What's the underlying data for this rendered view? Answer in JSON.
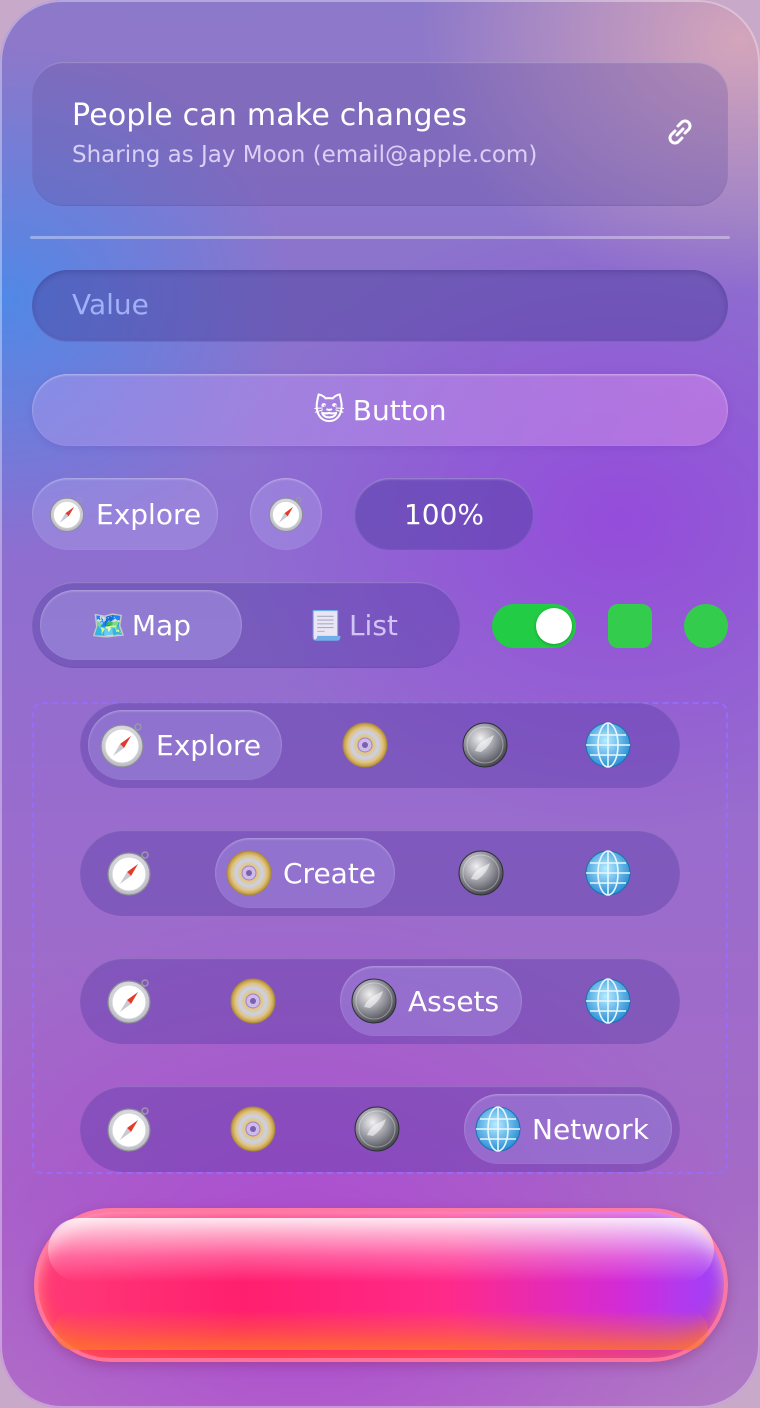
{
  "header": {
    "title": "People can make changes",
    "subtitle": "Sharing as Jay Moon (email@apple.com)",
    "icon": "link-icon"
  },
  "value_field": {
    "placeholder": "Value"
  },
  "main_button": {
    "emoji": "😺",
    "label": "Button"
  },
  "row_controls": {
    "explore_label": "Explore",
    "round_icon": "compass-icon",
    "percent_label": "100%"
  },
  "segmented": {
    "options": [
      {
        "emoji": "🗺️",
        "label": "Map",
        "selected": true
      },
      {
        "emoji": "📃",
        "label": "List",
        "selected": false
      }
    ]
  },
  "toggle": {
    "on": true,
    "color": "#22cc44"
  },
  "status_colors": {
    "square": "#33cc4c",
    "circle": "#33cc4c"
  },
  "tab_bars": [
    {
      "selected": "Explore",
      "items": [
        "Explore",
        "Create",
        "Assets",
        "Network"
      ]
    },
    {
      "selected": "Create",
      "items": [
        "Explore",
        "Create",
        "Assets",
        "Network"
      ]
    },
    {
      "selected": "Assets",
      "items": [
        "Explore",
        "Create",
        "Assets",
        "Network"
      ]
    },
    {
      "selected": "Network",
      "items": [
        "Explore",
        "Create",
        "Assets",
        "Network"
      ]
    }
  ],
  "tab_labels": {
    "explore": "Explore",
    "create": "Create",
    "assets": "Assets",
    "network": "Network"
  },
  "tab_icons": {
    "explore": "compass-icon",
    "create": "disc-icon",
    "assets": "coin-icon",
    "network": "globe-icon"
  }
}
